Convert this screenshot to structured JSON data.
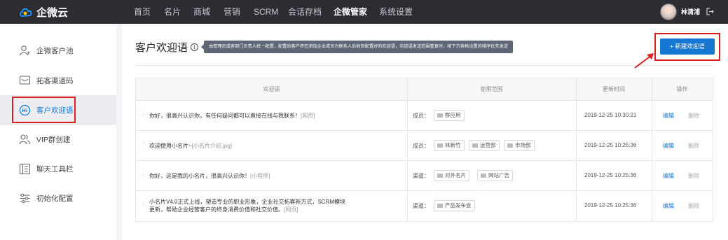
{
  "app": {
    "logo_text": "企微云"
  },
  "nav": {
    "items": [
      {
        "label": "首页"
      },
      {
        "label": "名片"
      },
      {
        "label": "商城"
      },
      {
        "label": "营销"
      },
      {
        "label": "SCRM"
      },
      {
        "label": "会话存档"
      },
      {
        "label": "企微管家"
      },
      {
        "label": "系统设置"
      }
    ],
    "active_index": 6
  },
  "user": {
    "name": "林清浦"
  },
  "sidebar": {
    "items": [
      {
        "label": "企微客户池",
        "icon": "user-icon"
      },
      {
        "label": "拓客渠道码",
        "icon": "message-icon"
      },
      {
        "label": "客户欢迎语",
        "icon": "greeting-icon"
      },
      {
        "label": "VIP群创建",
        "icon": "group-icon"
      },
      {
        "label": "聊天工具栏",
        "icon": "toolbar-icon"
      },
      {
        "label": "初始化配置",
        "icon": "sliders-icon"
      }
    ],
    "active_index": 2
  },
  "page": {
    "title": "客户欢迎语",
    "tooltip": "由管理员或者部门负责人统一配置，配置后客户将在添加企业成员为联系人后收到配置好的欢迎语，欢迎语发送范围重复时，按下方表格设置的排序优先发送",
    "new_button": "+ 新建欢迎语"
  },
  "table": {
    "headers": [
      "欢迎语",
      "使用范围",
      "更新时间",
      "操作"
    ],
    "rows": [
      {
        "text": "你好，很高兴认识你，有任何疑问都可以直接在线与我联系！",
        "tag": "[网页]",
        "scope_label": "成员：",
        "chips": [
          "群应用"
        ],
        "time": "2019-12-25  10:30:21",
        "edit": "编辑",
        "delete": "删除"
      },
      {
        "text": "欢迎使用小名片~",
        "tag": "[小名片介绍.jpg]",
        "scope_label": "成员：",
        "chips": [
          "林新竹",
          "运营部",
          "市场部"
        ],
        "time": "2019-12-25  10:25:36",
        "edit": "编辑",
        "delete": "删除"
      },
      {
        "text": "你好，这是我的小名片，很高兴认识你！",
        "tag": "[小程序]",
        "scope_label": "渠道：",
        "chips": [
          "对外名片",
          "网站广告"
        ],
        "time": "2019-12-25  10:25:36",
        "edit": "编辑",
        "delete": "删除"
      },
      {
        "text_line1": "小名片V4.0正式上线，塑造专业的职业形象，企业社交拓客新方式，SCRM模块",
        "text_line2": "更新，帮助企业经营客户的终身消费价值和社交价值。",
        "tag": "[网页]",
        "scope_label": "渠道：",
        "chips": [
          "产品发布会"
        ],
        "time": "2019-12-25  10:25:36",
        "edit": "编辑",
        "delete": "删除"
      }
    ]
  },
  "colors": {
    "accent": "#1677d2",
    "topbar": "#2b2d33",
    "highlight": "#d81e1e"
  }
}
